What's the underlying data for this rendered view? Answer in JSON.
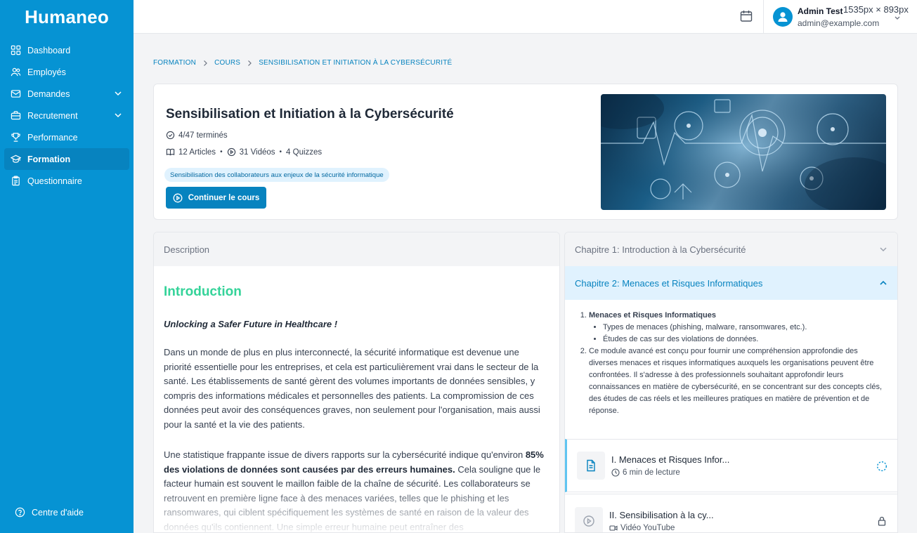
{
  "brand": "Humaneo",
  "sidebar": {
    "items": [
      {
        "label": "Dashboard",
        "icon": "grid-icon"
      },
      {
        "label": "Employés",
        "icon": "users-icon"
      },
      {
        "label": "Demandes",
        "icon": "mail-icon",
        "expandable": true
      },
      {
        "label": "Recrutement",
        "icon": "briefcase-icon",
        "expandable": true
      },
      {
        "label": "Performance",
        "icon": "trophy-icon"
      },
      {
        "label": "Formation",
        "icon": "graduation-cap-icon",
        "active": true
      },
      {
        "label": "Questionnaire",
        "icon": "clipboard-icon"
      }
    ],
    "help": "Centre d'aide"
  },
  "topbar": {
    "user_name": "Admin Test",
    "user_email": "admin@example.com",
    "dims_overlay": "1535px × 893px"
  },
  "breadcrumb": [
    "FORMATION",
    "COURS",
    "SENSIBILISATION ET INITIATION À LA CYBERSÉCURITÉ"
  ],
  "course": {
    "title": "Sensibilisation et Initiation à la Cybersécurité",
    "progress": "4/47 terminés",
    "articles": "12 Articles",
    "videos": "31 Vidéos",
    "quizzes": "4 Quizzes",
    "tag": "Sensibilisation des collaborateurs aux enjeux de la sécurité informatique",
    "continue_label": "Continuer le cours"
  },
  "description": {
    "tab": "Description",
    "heading": "Introduction",
    "quote": "Unlocking a Safer Future in Healthcare !",
    "para1": "Dans un monde de plus en plus interconnecté, la sécurité informatique est devenue une priorité essentielle pour les entreprises, et cela est particulièrement vrai dans le secteur de la santé. Les établissements de santé gèrent des volumes importants de données sensibles, y compris des informations médicales et personnelles des patients. La compromission de ces données peut avoir des conséquences graves, non seulement pour l'organisation, mais aussi pour la santé et la vie des patients.",
    "para2_start": "Une statistique frappante issue de divers rapports sur la cybersécurité indique qu'environ ",
    "para2_bold": "85% des violations de données sont causées par des erreurs humaines.",
    "para2_end": " Cela souligne que le facteur humain est souvent le maillon faible de la chaîne de sécurité. Les collaborateurs se retrouvent en première ligne face à des menaces variées, telles que le phishing et les ransomwares, qui ciblent spécifiquement les systèmes de santé en raison de la valeur des données qu'ils contiennent. Une simple erreur humaine peut entraîner des"
  },
  "chapters": {
    "ch1_title": "Chapitre 1: Introduction à la Cybersécurité",
    "ch2_title": "Chapitre 2: Menaces et Risques Informatiques",
    "ch2_item1": "Menaces et Risques Informatiques",
    "ch2_bullets": [
      "Types de menaces (phishing, malware, ransomwares, etc.).",
      "Études de cas sur des violations de données."
    ],
    "ch2_item2": "Ce module avancé est conçu pour fournir une compréhension approfondie des diverses menaces et risques informatiques auxquels les organisations peuvent être confrontées. Il s'adresse à des professionnels souhaitant approfondir leurs connaissances en matière de cybersécurité, en se concentrant sur des concepts clés, des études de cas réels et les meilleures pratiques en matière de prévention et de réponse.",
    "lessons": [
      {
        "title": "I. Menaces et Risques Infor...",
        "meta": "6 min de lecture",
        "icon": "document-icon",
        "status_icon": "in-progress-icon"
      },
      {
        "title": "II. Sensibilisation à la cy...",
        "meta": "Vidéo YouTube",
        "icon": "play-icon",
        "status_icon": "lock-icon"
      }
    ]
  },
  "colors": {
    "primary": "#0693d3",
    "primary_dark": "#0783bf",
    "heading_green": "#34d399"
  }
}
